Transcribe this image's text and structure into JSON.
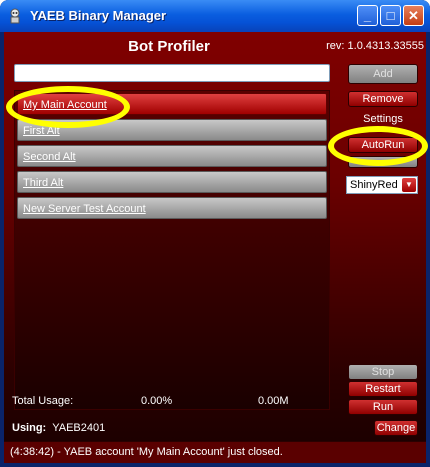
{
  "window": {
    "title": "YAEB Binary Manager",
    "controls": {
      "minimize": "_",
      "maximize": "□",
      "close": "✕"
    }
  },
  "header": {
    "title": "Bot Profiler",
    "revision": "rev: 1.0.4313.33555"
  },
  "search": {
    "value": "",
    "placeholder": ""
  },
  "profiles": [
    {
      "label": "My Main Account",
      "selected": true
    },
    {
      "label": "First Alt",
      "selected": false
    },
    {
      "label": "Second Alt",
      "selected": false
    },
    {
      "label": "Third Alt",
      "selected": false
    },
    {
      "label": "New Server Test Account",
      "selected": false
    }
  ],
  "actions": {
    "add": "Add",
    "remove": "Remove",
    "settings_label": "Settings",
    "autorun": "AutoRun",
    "theme": "ShinyRed",
    "stop": "Stop",
    "restart": "Restart",
    "run": "Run",
    "change": "Change"
  },
  "stats": {
    "total_usage_label": "Total Usage:",
    "cpu": "0.00%",
    "memory": "0.00M"
  },
  "using": {
    "label": "Using:",
    "value": "YAEB2401"
  },
  "status": "(4:38:42) - YAEB account 'My Main Account' just closed.",
  "colors": {
    "highlight": "#ffff00",
    "accent": "#c00000",
    "titlebar": "#0a5ee0"
  }
}
